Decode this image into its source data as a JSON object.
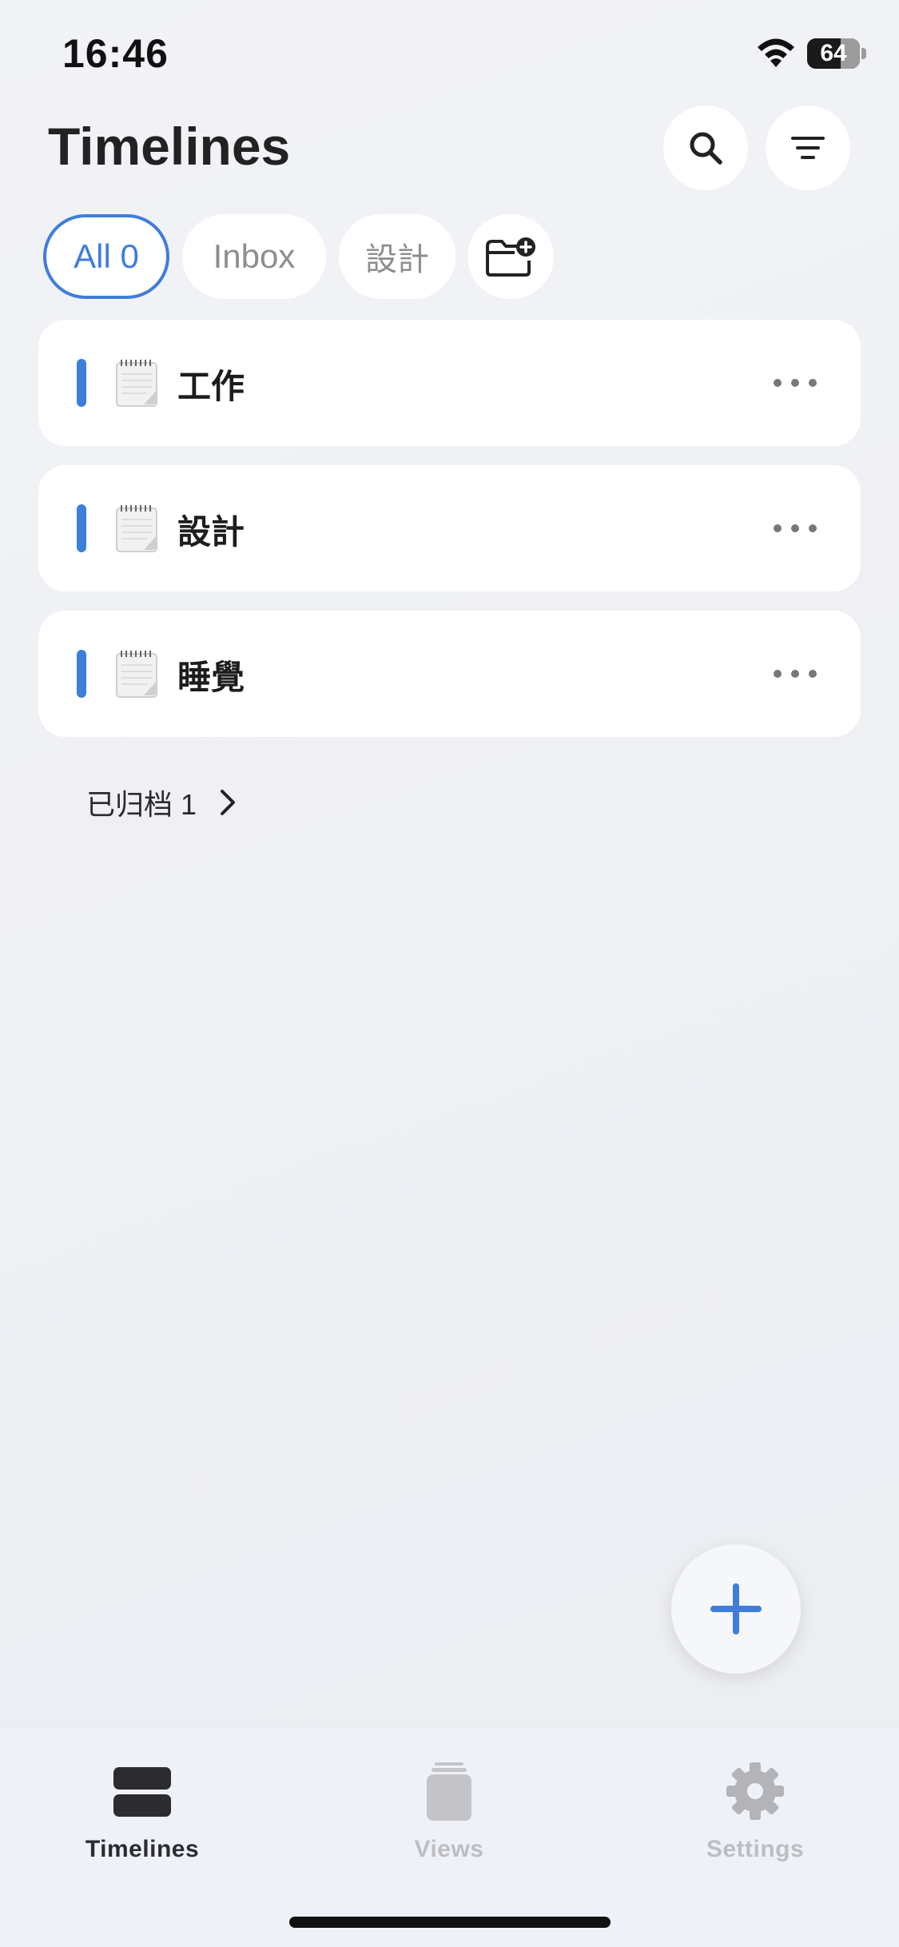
{
  "status_bar": {
    "time": "16:46",
    "battery_level": "64",
    "icons": [
      "wifi-icon",
      "battery-icon"
    ]
  },
  "header": {
    "title": "Timelines",
    "buttons": [
      "search-icon",
      "filter-icon"
    ]
  },
  "filters": {
    "chips": [
      {
        "label": "All 0",
        "selected": true
      },
      {
        "label": "Inbox",
        "selected": false
      },
      {
        "label": "設計",
        "selected": false
      }
    ],
    "add_folder_icon": "folder-plus-icon"
  },
  "timelines": [
    {
      "title": "工作",
      "icon": "notepad-icon"
    },
    {
      "title": "設計",
      "icon": "notepad-icon"
    },
    {
      "title": "睡覺",
      "icon": "notepad-icon"
    }
  ],
  "archived": {
    "label": "已归档 1"
  },
  "fab": {
    "icon": "plus-icon"
  },
  "tab_bar": {
    "tabs": [
      {
        "label": "Timelines",
        "icon": "timelines-icon",
        "active": true
      },
      {
        "label": "Views",
        "icon": "views-icon",
        "active": false
      },
      {
        "label": "Settings",
        "icon": "gear-icon",
        "active": false
      }
    ]
  },
  "colors": {
    "accent": "#3f7ddc",
    "card_bar": "#3b7fdb",
    "background": "#eff0f4",
    "inactive_tab": "#bdbdc2"
  }
}
